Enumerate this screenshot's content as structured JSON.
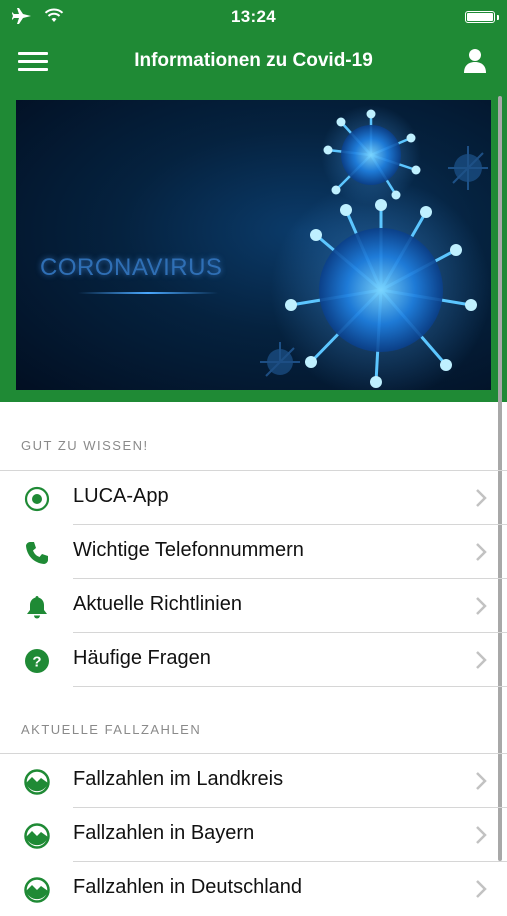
{
  "status_bar": {
    "time": "13:24",
    "icons": [
      "airplane-icon",
      "wifi-icon",
      "battery-icon"
    ]
  },
  "navbar": {
    "title": "Informationen zu Covid-19",
    "menu_icon": "hamburger-menu-icon",
    "profile_icon": "user-icon"
  },
  "banner": {
    "text": "CORONAVIRUS"
  },
  "sections": [
    {
      "header": "GUT ZU WISSEN!",
      "items": [
        {
          "label": "LUCA-App",
          "icon": "radio-target-icon"
        },
        {
          "label": "Wichtige Telefonnummern",
          "icon": "phone-icon"
        },
        {
          "label": "Aktuelle Richtlinien",
          "icon": "bell-icon"
        },
        {
          "label": "Häufige Fragen",
          "icon": "question-circle-icon"
        }
      ]
    },
    {
      "header": "AKTUELLE FALLZAHLEN",
      "items": [
        {
          "label": "Fallzahlen im Landkreis",
          "icon": "chart-circle-icon"
        },
        {
          "label": "Fallzahlen in Bayern",
          "icon": "chart-circle-icon"
        },
        {
          "label": "Fallzahlen in Deutschland",
          "icon": "chart-circle-icon"
        }
      ]
    }
  ],
  "colors": {
    "brand_green": "#1f8a35",
    "text": "#111111",
    "section_header": "#8a8a8a",
    "divider": "#d6d6d6"
  }
}
